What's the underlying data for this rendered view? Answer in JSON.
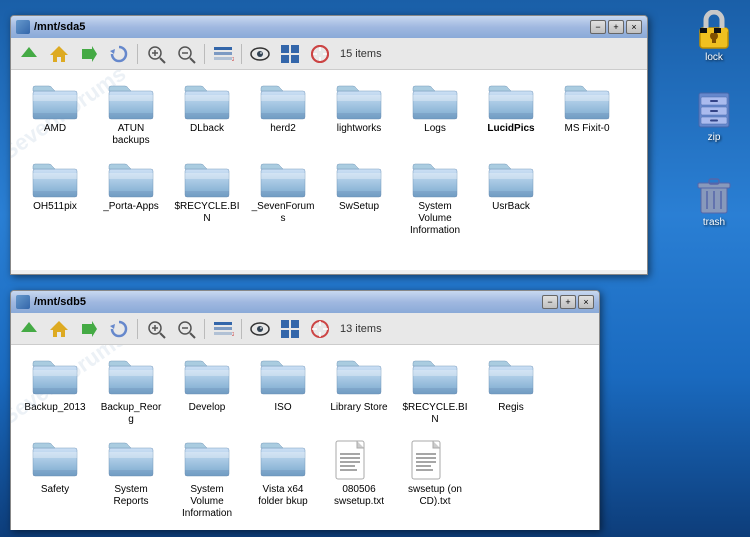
{
  "window1": {
    "title": "/mnt/sda5",
    "items_count": "15 items",
    "folders": [
      {
        "name": "AMD",
        "bold": false
      },
      {
        "name": "ATUN backups",
        "bold": false
      },
      {
        "name": "DLback",
        "bold": false
      },
      {
        "name": "herd2",
        "bold": false
      },
      {
        "name": "lightworks",
        "bold": false
      },
      {
        "name": "Logs",
        "bold": false
      },
      {
        "name": "LucidPics",
        "bold": true
      },
      {
        "name": "MS Fixit-0",
        "bold": false
      },
      {
        "name": "OH511pix",
        "bold": false
      },
      {
        "name": "_Porta-Apps",
        "bold": false
      },
      {
        "name": "$RECYCLE.BIN",
        "bold": false
      },
      {
        "name": "_SevenForums",
        "bold": false
      },
      {
        "name": "SwSetup",
        "bold": false
      },
      {
        "name": "System Volume Information",
        "bold": false
      },
      {
        "name": "UsrBack",
        "bold": false
      }
    ]
  },
  "window2": {
    "title": "/mnt/sdb5",
    "items_count": "13 items",
    "folders": [
      {
        "name": "Backup_2013",
        "bold": false,
        "type": "folder"
      },
      {
        "name": "Backup_Reorg",
        "bold": false,
        "type": "folder"
      },
      {
        "name": "Develop",
        "bold": false,
        "type": "folder"
      },
      {
        "name": "ISO",
        "bold": false,
        "type": "folder"
      },
      {
        "name": "Library Store",
        "bold": false,
        "type": "folder"
      },
      {
        "name": "$RECYCLE.BIN",
        "bold": false,
        "type": "folder"
      },
      {
        "name": "Regis",
        "bold": false,
        "type": "folder"
      },
      {
        "name": "Safety",
        "bold": false,
        "type": "folder"
      },
      {
        "name": "System Reports",
        "bold": false,
        "type": "folder"
      },
      {
        "name": "System Volume Information",
        "bold": false,
        "type": "folder"
      },
      {
        "name": "Vista x64 folder bkup",
        "bold": false,
        "type": "folder"
      },
      {
        "name": "080506 swsetup.txt",
        "bold": false,
        "type": "txt"
      },
      {
        "name": "swsetup (on CD).txt",
        "bold": false,
        "type": "txt"
      }
    ]
  },
  "desktop": {
    "icons": [
      {
        "name": "lock",
        "label": "lock"
      },
      {
        "name": "zip",
        "label": "zip"
      },
      {
        "name": "trash",
        "label": "trash"
      }
    ]
  },
  "toolbar": {
    "buttons": [
      "up",
      "home",
      "forward",
      "refresh",
      "zoom-in",
      "zoom-out",
      "view-list",
      "sort",
      "show-hidden",
      "view-icons",
      "help"
    ]
  }
}
